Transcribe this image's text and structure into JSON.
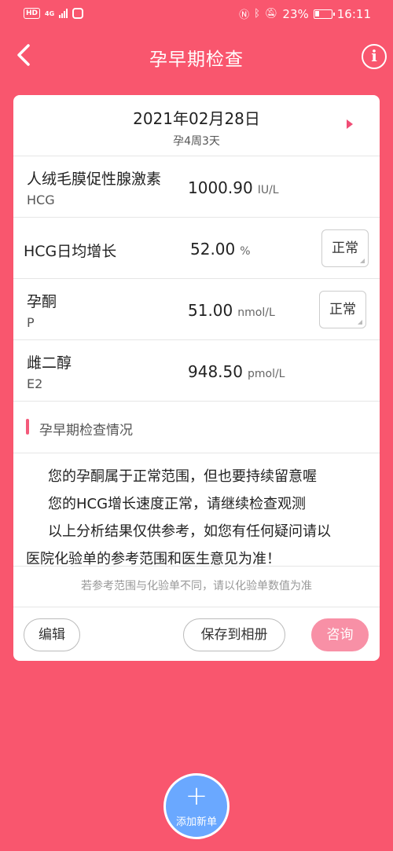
{
  "status_bar": {
    "left_badges": [
      "HD",
      "4G"
    ],
    "battery_percent": "23%",
    "time": "16:11",
    "icons": [
      "nfc-icon",
      "bluetooth-icon",
      "mute-icon",
      "battery-icon"
    ]
  },
  "header": {
    "title": "孕早期检查",
    "info_label": "i"
  },
  "date": {
    "main": "2021年02月28日",
    "sub": "孕4周3天"
  },
  "results": [
    {
      "name": "人绒毛膜促性腺激素",
      "code": "HCG",
      "value": "1000.90",
      "unit": "IU/L",
      "status": ""
    },
    {
      "name": "HCG日均增长",
      "code": "",
      "value": "52.00",
      "unit": "%",
      "status": "正常"
    },
    {
      "name": "孕酮",
      "code": "P",
      "value": "51.00",
      "unit": "nmol/L",
      "status": "正常"
    },
    {
      "name": "雌二醇",
      "code": "E2",
      "value": "948.50",
      "unit": "pmol/L",
      "status": ""
    }
  ],
  "section": {
    "title": "孕早期检查情况"
  },
  "analysis": {
    "line1": "您的孕酮属于正常范围，但也要持续留意喔",
    "line2": "您的HCG增长速度正常，请继续检查观测",
    "line3": "以上分析结果仅供参考，如您有任何疑问请以",
    "line4": "医院化验单的参考范围和医生意见为准！"
  },
  "note": "若参考范围与化验单不同，请以化验单数值为准",
  "actions": {
    "edit": "编辑",
    "save": "保存到相册",
    "consult": "咨询"
  },
  "fab": {
    "plus": "+",
    "label": "添加新单"
  },
  "colors": {
    "background": "#f9566e",
    "accent": "#f04d75",
    "consult_button": "#f890a6",
    "fab": "#6aa8ff"
  }
}
